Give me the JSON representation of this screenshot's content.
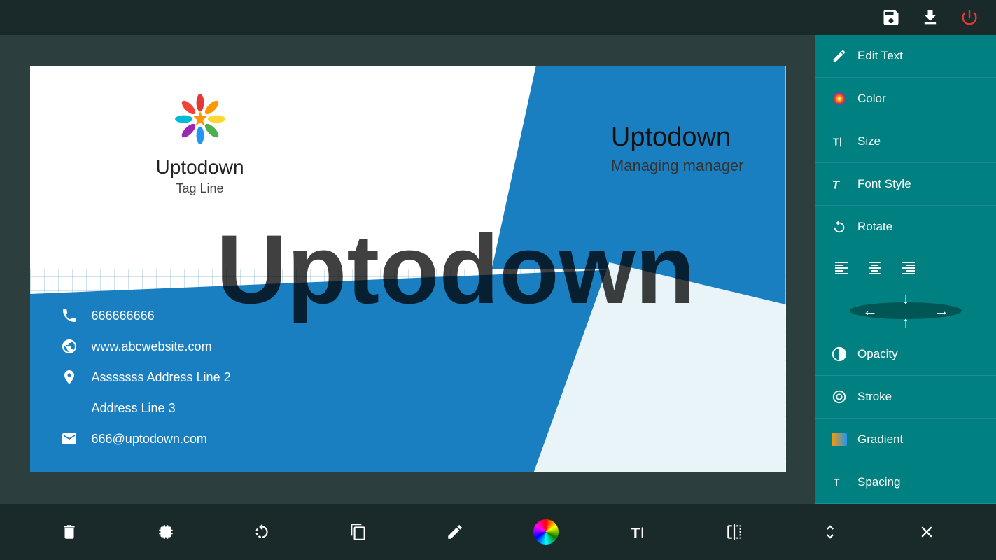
{
  "topbar": {
    "save_icon": "💾",
    "download_icon": "⬇",
    "power_icon": "⏻"
  },
  "card": {
    "logo_alt": "Uptodown Logo",
    "company_name": "Uptodown",
    "tag_line": "Tag Line",
    "right_company": "Uptodown",
    "right_title": "Managing manager",
    "watermark": "Uptodown",
    "contacts": [
      {
        "icon": "📞",
        "text": "666666666",
        "type": "phone"
      },
      {
        "icon": "🌐",
        "text": "www.abcwebsite.com",
        "type": "website"
      },
      {
        "icon": "📍",
        "text": "Asssssss    Address Line 2",
        "type": "address1"
      },
      {
        "icon": "",
        "text": "Address Line 3",
        "type": "address2"
      },
      {
        "icon": "✉",
        "text": "666@uptodown.com",
        "type": "email"
      }
    ]
  },
  "rightPanel": {
    "items": [
      {
        "id": "edit-text",
        "icon": "✏",
        "label": "Edit Text"
      },
      {
        "id": "color",
        "icon": "🎨",
        "label": "Color"
      },
      {
        "id": "size",
        "icon": "T",
        "label": "Size"
      },
      {
        "id": "font-style",
        "icon": "T",
        "label": "Font Style"
      },
      {
        "id": "rotate",
        "icon": "↻",
        "label": "Rotate"
      }
    ],
    "align_icons": [
      "≡",
      "≡",
      "≡"
    ],
    "nav_arrows": {
      "up": "↑",
      "down": "↓",
      "left": "←",
      "right": "→"
    },
    "bottom_items": [
      {
        "id": "opacity",
        "icon": "◑",
        "label": "Opacity"
      },
      {
        "id": "stroke",
        "icon": "◎",
        "label": "Stroke"
      },
      {
        "id": "gradient",
        "icon": "▣",
        "label": "Gradient"
      },
      {
        "id": "spacing",
        "icon": "T",
        "label": "Spacing"
      }
    ]
  },
  "bottomToolbar": {
    "delete_label": "🗑",
    "rotate_cw_label": "↷",
    "rotate_ccw_label": "↑",
    "copy_label": "⧉",
    "edit_label": "✏",
    "color_label": "color",
    "text_label": "T",
    "flip_label": "⇌",
    "expand_label": "⤢",
    "close_label": "✕"
  }
}
